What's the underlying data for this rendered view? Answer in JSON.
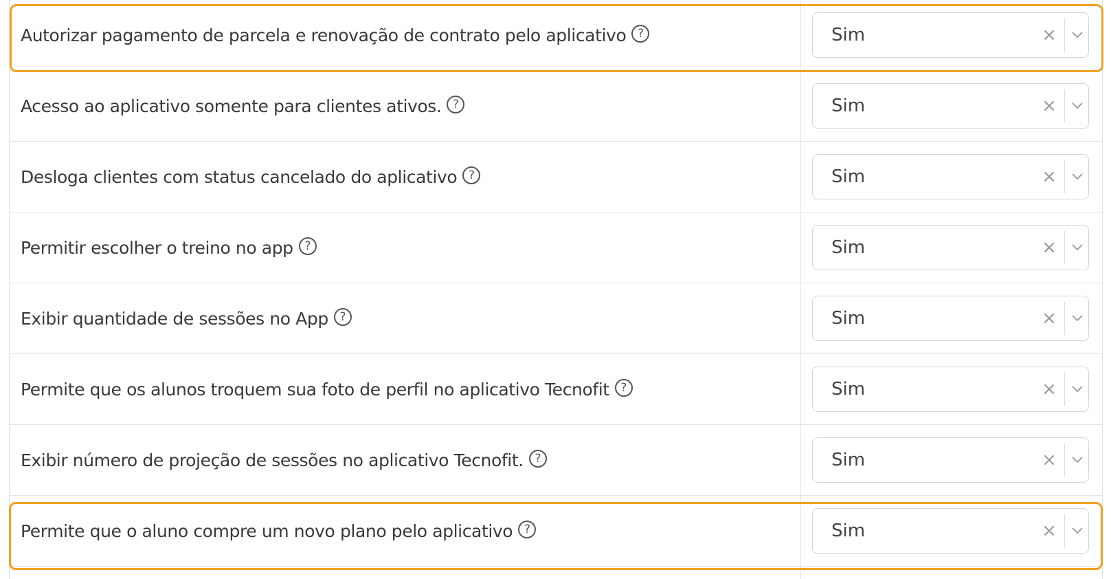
{
  "colors": {
    "highlight": "#f0a020",
    "border": "#e3e3e3",
    "text": "#3a3a3a"
  },
  "icons": {
    "help": "question-circle-icon",
    "clear": "close-icon",
    "chevron": "chevron-down-icon"
  },
  "rows": [
    {
      "label": "Autorizar pagamento de parcela e renovação de contrato pelo aplicativo",
      "help": "?",
      "value": "Sim",
      "clear": "×",
      "highlighted": true
    },
    {
      "label": "Acesso ao aplicativo somente para clientes ativos.",
      "help": "?",
      "value": "Sim",
      "clear": "×",
      "highlighted": false
    },
    {
      "label": "Desloga clientes com status cancelado do aplicativo",
      "help": "?",
      "value": "Sim",
      "clear": "×",
      "highlighted": false
    },
    {
      "label": "Permitir escolher o treino no app",
      "help": "?",
      "value": "Sim",
      "clear": "×",
      "highlighted": false
    },
    {
      "label": "Exibir quantidade de sessões no App",
      "help": "?",
      "value": "Sim",
      "clear": "×",
      "highlighted": false
    },
    {
      "label": "Permite que os alunos troquem sua foto de perfil no aplicativo Tecnofit",
      "help": "?",
      "value": "Sim",
      "clear": "×",
      "highlighted": false
    },
    {
      "label": "Exibir número de projeção de sessões no aplicativo Tecnofit.",
      "help": "?",
      "value": "Sim",
      "clear": "×",
      "highlighted": false
    },
    {
      "label": "Permite que o aluno compre um novo plano pelo aplicativo",
      "help": "?",
      "value": "Sim",
      "clear": "×",
      "highlighted": true
    }
  ]
}
